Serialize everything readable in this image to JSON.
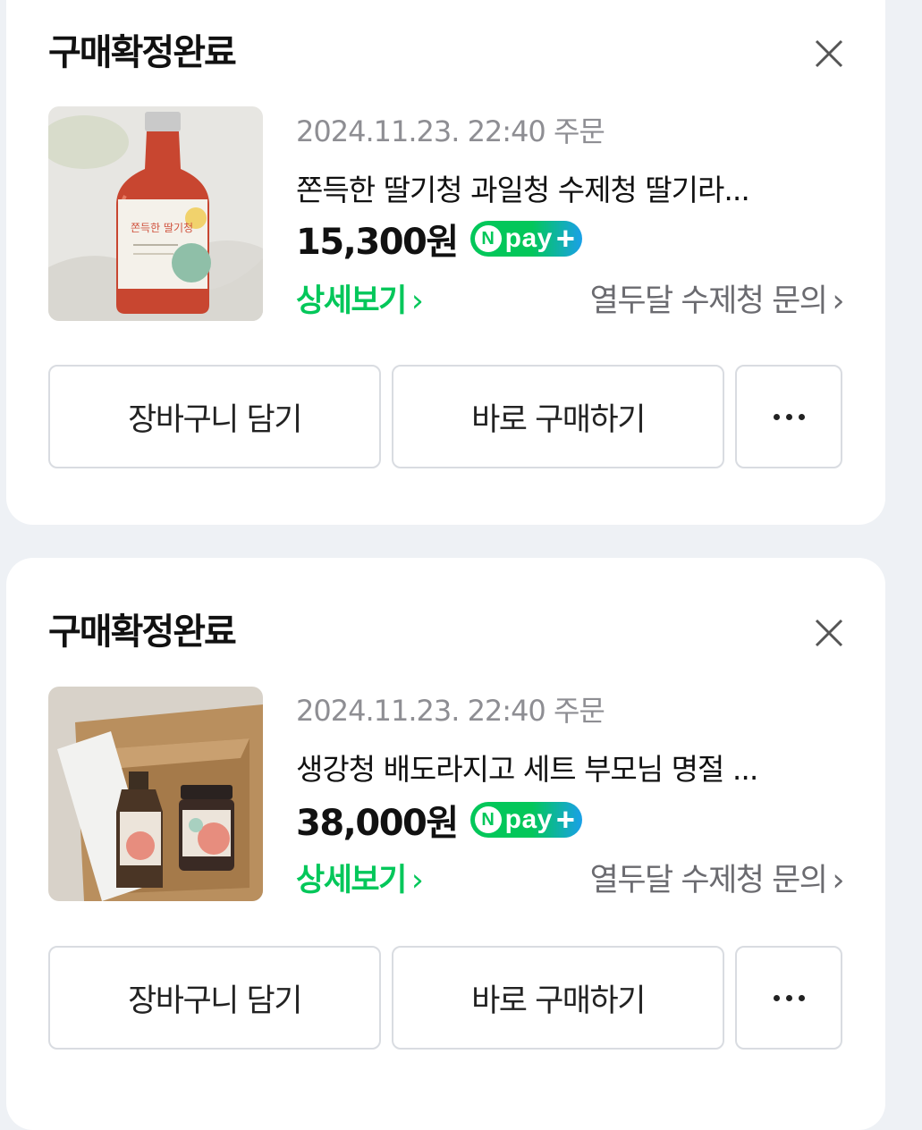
{
  "orders": [
    {
      "status_title": "구매확정완료",
      "order_date": "2024.11.23. 22:40 주문",
      "product_name": "쫀득한 딸기청 과일청 수제청 딸기라...",
      "price": "15,300원",
      "npay": {
        "n": "N",
        "text": "pay",
        "plus": "+"
      },
      "detail_link": "상세보기",
      "seller_link": "열두달 수제청 문의",
      "buttons": {
        "cart": "장바구니 담기",
        "buy": "바로 구매하기"
      },
      "thumbnail_label": "쫀득한 딸기청"
    },
    {
      "status_title": "구매확정완료",
      "order_date": "2024.11.23. 22:40 주문",
      "product_name": "생강청 배도라지고 세트 부모님 명절 ...",
      "price": "38,000원",
      "npay": {
        "n": "N",
        "text": "pay",
        "plus": "+"
      },
      "detail_link": "상세보기",
      "seller_link": "열두달 수제청 문의",
      "buttons": {
        "cart": "장바구니 담기",
        "buy": "바로 구매하기"
      }
    }
  ],
  "colors": {
    "accent_green": "#03c75a",
    "npay_blue": "#1aa0e8",
    "background": "#eef1f5"
  },
  "icons": {
    "close": "close-icon",
    "chevron": "chevron-right-icon",
    "more": "more-dots-icon"
  }
}
